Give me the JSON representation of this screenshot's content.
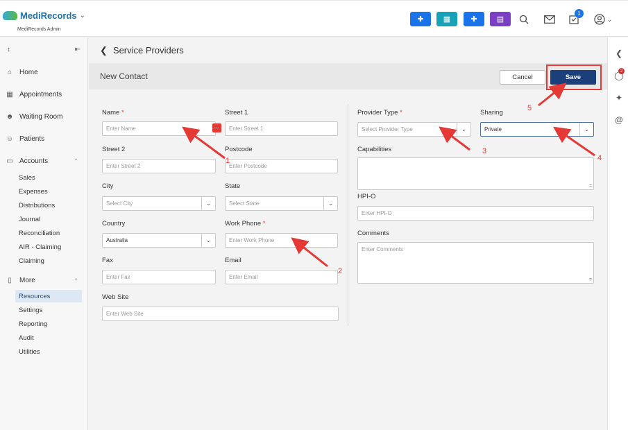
{
  "app": {
    "name": "MediRecords",
    "subtitle": "MediRecords Admin"
  },
  "topbar": {
    "buttons": [
      {
        "name": "add-patient-button",
        "icon": "person-plus-icon",
        "color": "#1a73e8"
      },
      {
        "name": "calendar-button",
        "icon": "calendar-icon",
        "color": "#17a2b8"
      },
      {
        "name": "medical-kit-button",
        "icon": "medkit-icon",
        "color": "#1a73e8"
      },
      {
        "name": "clipboard-button",
        "icon": "clipboard-icon",
        "color": "#7b3fc4"
      }
    ],
    "task_badge": "1"
  },
  "sidebar": {
    "items": [
      {
        "label": "Home",
        "icon": "home-icon"
      },
      {
        "label": "Appointments",
        "icon": "calendar-icon"
      },
      {
        "label": "Waiting Room",
        "icon": "people-icon"
      },
      {
        "label": "Patients",
        "icon": "person-icon"
      },
      {
        "label": "Accounts",
        "icon": "folder-icon"
      },
      {
        "label": "More",
        "icon": "folder-open-icon"
      }
    ],
    "accounts_sub": [
      "Sales",
      "Expenses",
      "Distributions",
      "Journal",
      "Reconciliation",
      "AIR - Claiming",
      "Claiming"
    ],
    "more_sub": [
      "Resources",
      "Settings",
      "Reporting",
      "Audit",
      "Utilities"
    ]
  },
  "page": {
    "title": "Service Providers",
    "section": "New Contact"
  },
  "actions": {
    "cancel": "Cancel",
    "save": "Save"
  },
  "form": {
    "name": {
      "label": "Name",
      "required": "*",
      "placeholder": "Enter Name"
    },
    "street1": {
      "label": "Street 1",
      "placeholder": "Enter Street 1"
    },
    "street2": {
      "label": "Street 2",
      "placeholder": "Enter Street 2"
    },
    "postcode": {
      "label": "Postcode",
      "placeholder": "Enter Postcode"
    },
    "city": {
      "label": "City",
      "placeholder": "Select City"
    },
    "state": {
      "label": "State",
      "placeholder": "Select State"
    },
    "country": {
      "label": "Country",
      "value": "Australia"
    },
    "work_phone": {
      "label": "Work Phone",
      "required": "*",
      "placeholder": "Enter Work Phone"
    },
    "fax": {
      "label": "Fax",
      "placeholder": "Enter Fax"
    },
    "email": {
      "label": "Email",
      "placeholder": "Enter Email"
    },
    "website": {
      "label": "Web Site",
      "placeholder": "Enter Web Site"
    },
    "provider_type": {
      "label": "Provider Type",
      "required": "*",
      "placeholder": "Select Provider Type"
    },
    "sharing": {
      "label": "Sharing",
      "value": "Private"
    },
    "capabilities": {
      "label": "Capabilities"
    },
    "hpio": {
      "label": "HPI-O",
      "placeholder": "Enter HPI-O"
    },
    "comments": {
      "label": "Comments",
      "placeholder": "Enter Comments"
    }
  },
  "rail": {
    "badge": "2"
  },
  "annotations": [
    "1",
    "2",
    "3",
    "4",
    "5"
  ],
  "colors": {
    "accent": "#1a3f7a",
    "annotation": "#e53935"
  }
}
